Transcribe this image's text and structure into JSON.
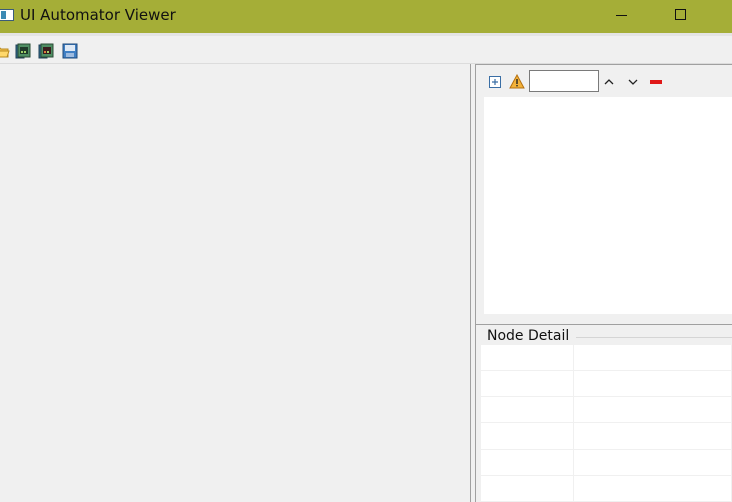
{
  "window": {
    "title": "UI Automator Viewer",
    "accent_color": "#a5ae37"
  },
  "toolbar": {
    "buttons": [
      {
        "icon": "open-folder-icon"
      },
      {
        "icon": "device-screenshot-icon"
      },
      {
        "icon": "device-screenshot-compressed-icon"
      },
      {
        "icon": "save-icon"
      }
    ]
  },
  "hierarchy_toolbar": {
    "filter_value": "",
    "icons": [
      "expand-all-icon",
      "nafs-warning-icon",
      "previous-node-icon",
      "next-node-icon",
      "clear-filter-icon"
    ]
  },
  "node_detail": {
    "title": "Node Detail",
    "rows": [
      {
        "key": "",
        "value": ""
      },
      {
        "key": "",
        "value": ""
      },
      {
        "key": "",
        "value": ""
      },
      {
        "key": "",
        "value": ""
      },
      {
        "key": "",
        "value": ""
      },
      {
        "key": "",
        "value": ""
      }
    ]
  }
}
